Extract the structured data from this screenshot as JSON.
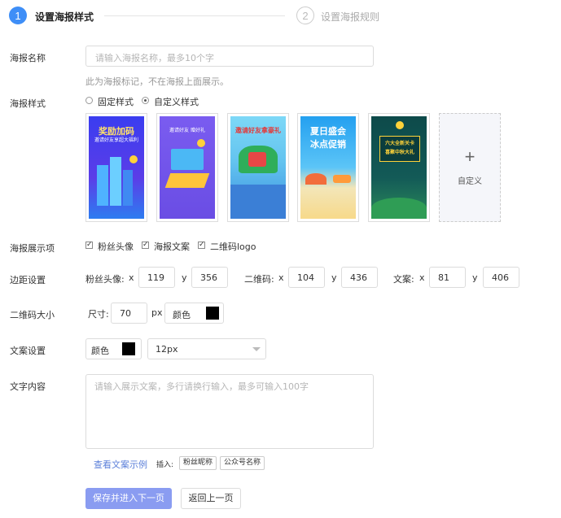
{
  "steps": [
    {
      "num": "1",
      "label": "设置海报样式"
    },
    {
      "num": "2",
      "label": "设置海报规则"
    }
  ],
  "poster_name": {
    "label": "海报名称",
    "placeholder": "请输入海报名称，最多10个字",
    "hint": "此为海报标记，不在海报上面展示。"
  },
  "poster_style": {
    "label": "海报样式",
    "options": [
      "固定样式",
      "自定义样式"
    ],
    "selected": "自定义样式",
    "templates": [
      {
        "caption": "奖励加码",
        "sub": "邀请好友享超大福利"
      },
      {
        "caption": "",
        "sub": "邀请好友 赠好礼"
      },
      {
        "caption": "邀请好友拿豪礼",
        "sub": ""
      },
      {
        "caption": "夏日盛会",
        "sub": "冰点促销"
      },
      {
        "caption": "六大全新关卡",
        "sub": "喜聚中秋大礼"
      }
    ],
    "custom_label": "自定义",
    "custom_symbol": "+"
  },
  "display_items": {
    "label": "海报展示项",
    "items": [
      "粉丝头像",
      "海报文案",
      "二维码logo"
    ]
  },
  "margin": {
    "label": "边距设置",
    "groups": [
      {
        "name": "粉丝头像:",
        "x": "119",
        "y": "356"
      },
      {
        "name": "二维码:",
        "x": "104",
        "y": "436"
      },
      {
        "name": "文案:",
        "x": "81",
        "y": "406"
      }
    ],
    "x_label": "x",
    "y_label": "y"
  },
  "qr_size": {
    "label": "二维码大小",
    "size_label": "尺寸:",
    "size_value": "70",
    "unit": "px",
    "color_label": "颜色",
    "color": "#000000"
  },
  "text_settings": {
    "label": "文案设置",
    "color_label": "颜色",
    "color": "#000000",
    "font_size": "12px"
  },
  "text_content": {
    "label": "文字内容",
    "placeholder": "请输入展示文案，多行请换行输入，最多可输入100字",
    "example_link": "查看文案示例",
    "insert_label": "插入:",
    "tags": [
      "粉丝昵称",
      "公众号名称"
    ]
  },
  "actions": {
    "primary": "保存并进入下一页",
    "secondary": "返回上一页"
  },
  "colors": {
    "accent": "#3e8ef7",
    "primary_button": "#8a9cf1"
  }
}
